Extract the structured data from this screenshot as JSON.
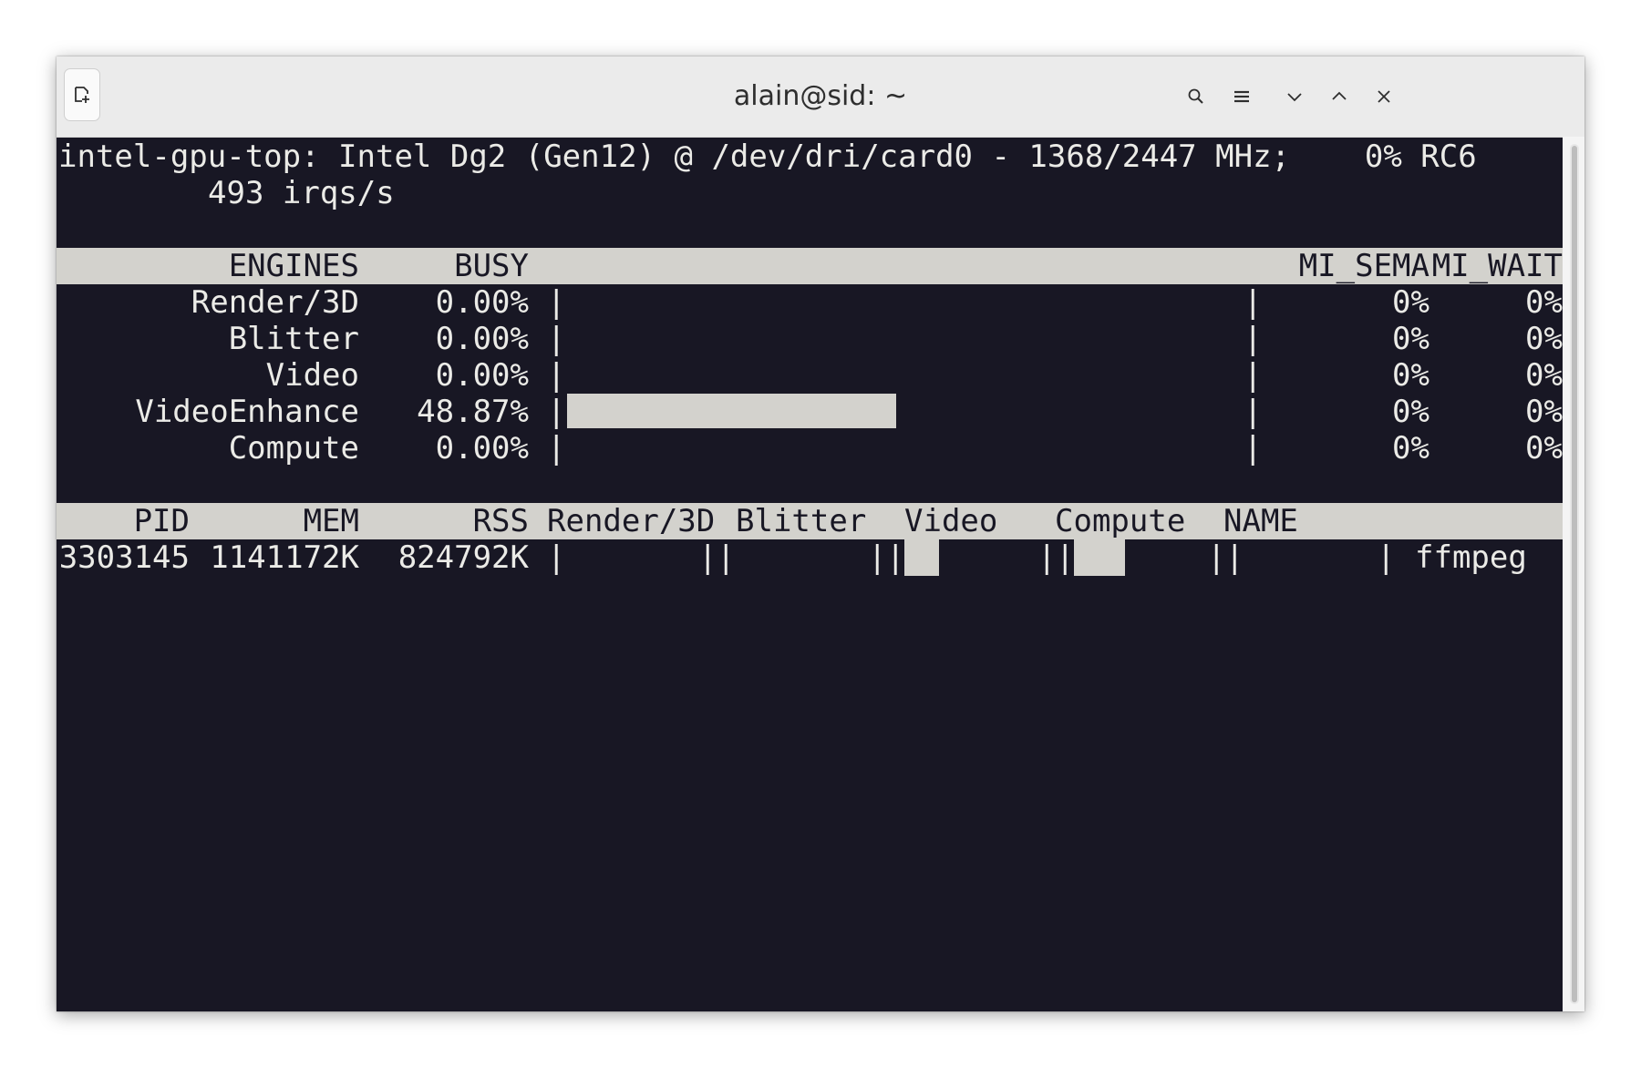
{
  "window": {
    "title": "alain@sid: ~",
    "icons": [
      "new-tab-icon",
      "search-icon",
      "menu-icon",
      "minimize-icon",
      "maximize-icon",
      "close-icon"
    ]
  },
  "terminal": {
    "header_line": "intel-gpu-top: Intel Dg2 (Gen12) @ /dev/dri/card0 - 1368/2447 MHz;    0% RC6",
    "irq_line": "493 irqs/s",
    "engines_header": {
      "engines": "ENGINES",
      "busy": "BUSY",
      "mi_sema": "MI_SEMA",
      "mi_wait": "MI_WAIT"
    },
    "engines": [
      {
        "name": "Render/3D",
        "busy": "0.00%",
        "busy_fraction": 0.0,
        "mi_sema": "0%",
        "mi_wait": "0%"
      },
      {
        "name": "Blitter",
        "busy": "0.00%",
        "busy_fraction": 0.0,
        "mi_sema": "0%",
        "mi_wait": "0%"
      },
      {
        "name": "Video",
        "busy": "0.00%",
        "busy_fraction": 0.0,
        "mi_sema": "0%",
        "mi_wait": "0%"
      },
      {
        "name": "VideoEnhance",
        "busy": "48.87%",
        "busy_fraction": 0.4887,
        "mi_sema": "0%",
        "mi_wait": "0%"
      },
      {
        "name": "Compute",
        "busy": "0.00%",
        "busy_fraction": 0.0,
        "mi_sema": "0%",
        "mi_wait": "0%"
      }
    ],
    "bar_separator": "|",
    "process_header": {
      "pid": "PID",
      "mem": "MEM",
      "rss": "RSS",
      "render3d": "Render/3D",
      "blitter": "Blitter",
      "video": "Video",
      "compute": "Compute",
      "name": "NAME"
    },
    "processes": [
      {
        "pid": "3303145",
        "mem": "1141172K",
        "rss": "824792K",
        "render3d_fraction": 0.0,
        "blitter_fraction": 0.0,
        "video_fraction": 0.27,
        "videoenhance_fraction": 0.4,
        "compute_fraction": 0.0,
        "name": "ffmpeg"
      }
    ]
  }
}
